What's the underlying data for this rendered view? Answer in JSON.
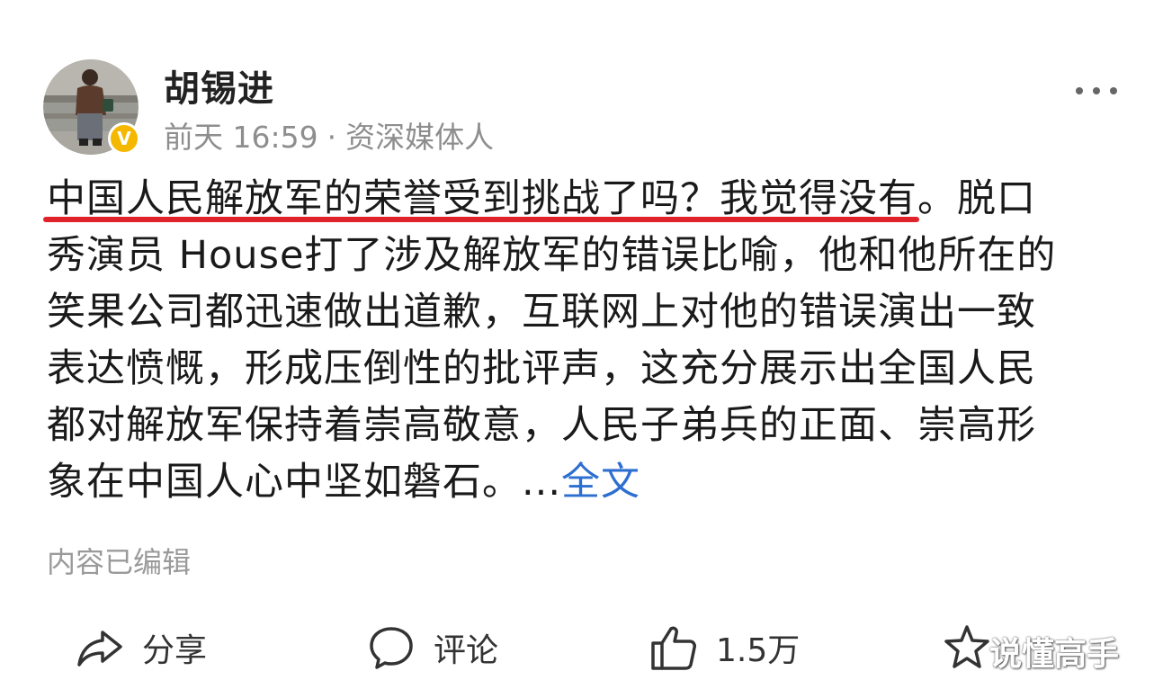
{
  "author": {
    "name": "胡锡进",
    "time": "前天 16:59",
    "separator": "·",
    "title": "资深媒体人",
    "badge": "V"
  },
  "post": {
    "lines": [
      {
        "parts": [
          {
            "text": "中国人民解放军的荣誉受到挑战了吗？",
            "highlight": true
          },
          {
            "text": "",
            "highlight": false
          },
          {
            "text": "我觉得没有",
            "highlight": true
          },
          {
            "text": "。脱口",
            "highlight": false
          }
        ]
      },
      {
        "text": "秀演员 House打了涉及解放军的错误比喻，他和他所在的"
      },
      {
        "text": "笑果公司都迅速做出道歉，互联网上对他的错误演出一致"
      },
      {
        "text": "表达愤慨，形成压倒性的批评声，这充分展示出全国人民"
      },
      {
        "text": "都对解放军保持着崇高敬意，人民子弟兵的正面、崇高形"
      },
      {
        "text": "象在中国人心中坚如磐石。"
      }
    ],
    "ellipsis": "...",
    "full_text_link": "全文",
    "edited_note": "内容已编辑"
  },
  "actions": {
    "share": "分享",
    "comment": "评论",
    "like_count": "1.5万"
  },
  "colors": {
    "highlight_underline": "#e0232b",
    "link": "#2d6fd0",
    "meta": "#8e8e8e",
    "badge": "#f5b800"
  },
  "watermark": "说懂高手"
}
